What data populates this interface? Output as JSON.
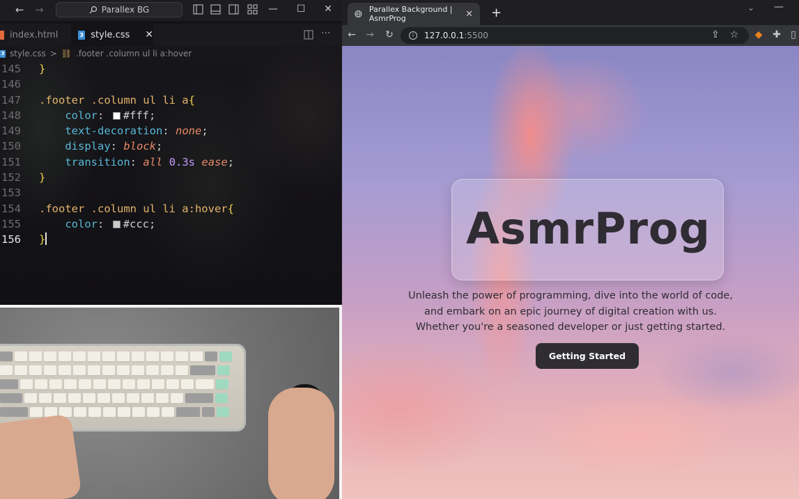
{
  "vscode": {
    "search_label": "Parallex BG",
    "tabs": [
      {
        "label": "index.html"
      },
      {
        "label": "style.css"
      }
    ],
    "breadcrumb": {
      "file": "style.css",
      "separator": ">",
      "selector": ".footer .column ul li a:hover"
    },
    "line_numbers": [
      "145",
      "146",
      "147",
      "148",
      "149",
      "150",
      "151",
      "152",
      "153",
      "154",
      "155",
      "156"
    ],
    "code": {
      "l145": "}",
      "l147_sel": ".footer .column ul li a",
      "l147_brace": "{",
      "l148_prop": "color",
      "l148_val": "#fff",
      "l149_prop": "text-decoration",
      "l149_val": "none",
      "l150_prop": "display",
      "l150_val": "block",
      "l151_prop": "transition",
      "l151_val1": "all",
      "l151_val2": "0.3s",
      "l151_val3": "ease",
      "l152": "}",
      "l154_sel": ".footer .column ul li a:hover",
      "l154_brace": "{",
      "l155_prop": "color",
      "l155_val": "#ccc",
      "l156": "}",
      "colon": ":",
      "semicolon": ";"
    },
    "colors": {
      "swatch_fff": "#ffffff",
      "swatch_ccc": "#cccccc"
    }
  },
  "browser": {
    "tab_title": "Parallex Background | AsmrProg",
    "url_host": "127.0.0.1",
    "url_port": ":5500"
  },
  "page": {
    "title": "AsmrProg",
    "tagline_lines": [
      "Unleash the power of programming, dive into the world of code,",
      "and embark on an epic journey of digital creation with us.",
      "Whether you're a seasoned developer or just getting started."
    ],
    "cta_label": "Getting Started"
  }
}
